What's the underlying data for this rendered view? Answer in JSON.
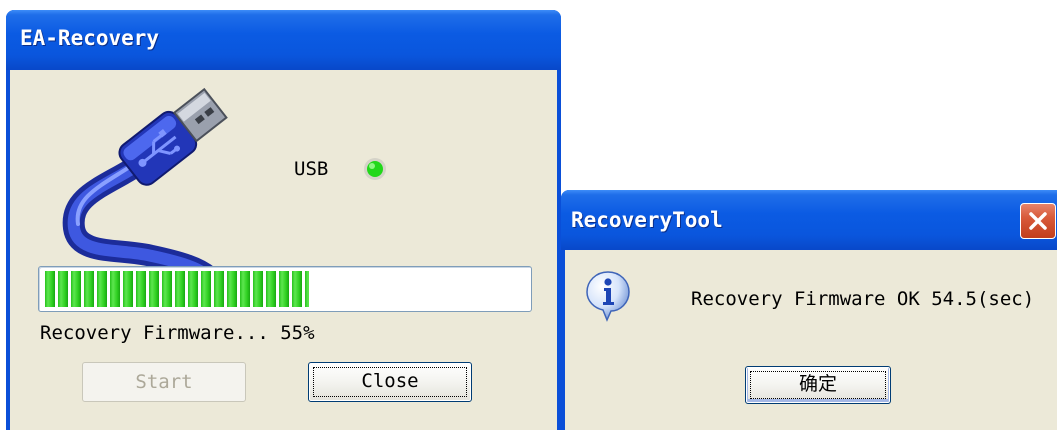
{
  "ea_window": {
    "title": "EA-Recovery",
    "usb_label": "USB",
    "usb_status_color": "#22d81a",
    "progress_percent": 55,
    "status_text": "Recovery Firmware... 55%",
    "start_label": "Start",
    "close_label": "Close"
  },
  "dialog": {
    "title": "RecoveryTool",
    "icon": "info-icon",
    "message": "Recovery Firmware OK 54.5(sec)",
    "ok_label": "确定"
  }
}
